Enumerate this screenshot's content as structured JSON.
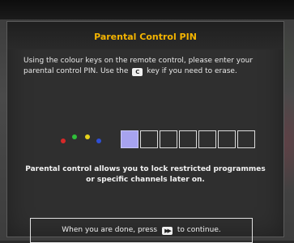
{
  "dialog": {
    "title": "Parental Control PIN",
    "instructions_1": "Using the colour keys on the remote control, please enter your parental control PIN. Use the",
    "clear_key_label": "C",
    "instructions_2": "key if you need to erase.",
    "note": "Parental control allows you to lock restricted programmes or specific channels later on.",
    "footer_before": "When you are done, press",
    "footer_after": "to continue.",
    "footer_icon": "fast-forward-icon"
  },
  "colour_keys": [
    {
      "name": "red",
      "color": "#d62828"
    },
    {
      "name": "green",
      "color": "#2fbf3a"
    },
    {
      "name": "yellow",
      "color": "#e6d21b"
    },
    {
      "name": "blue",
      "color": "#2f4fd6"
    }
  ],
  "pin": {
    "length": 7,
    "active_index": 0
  },
  "colors": {
    "title": "#f4b400",
    "active_box": "#a7a3ef"
  }
}
